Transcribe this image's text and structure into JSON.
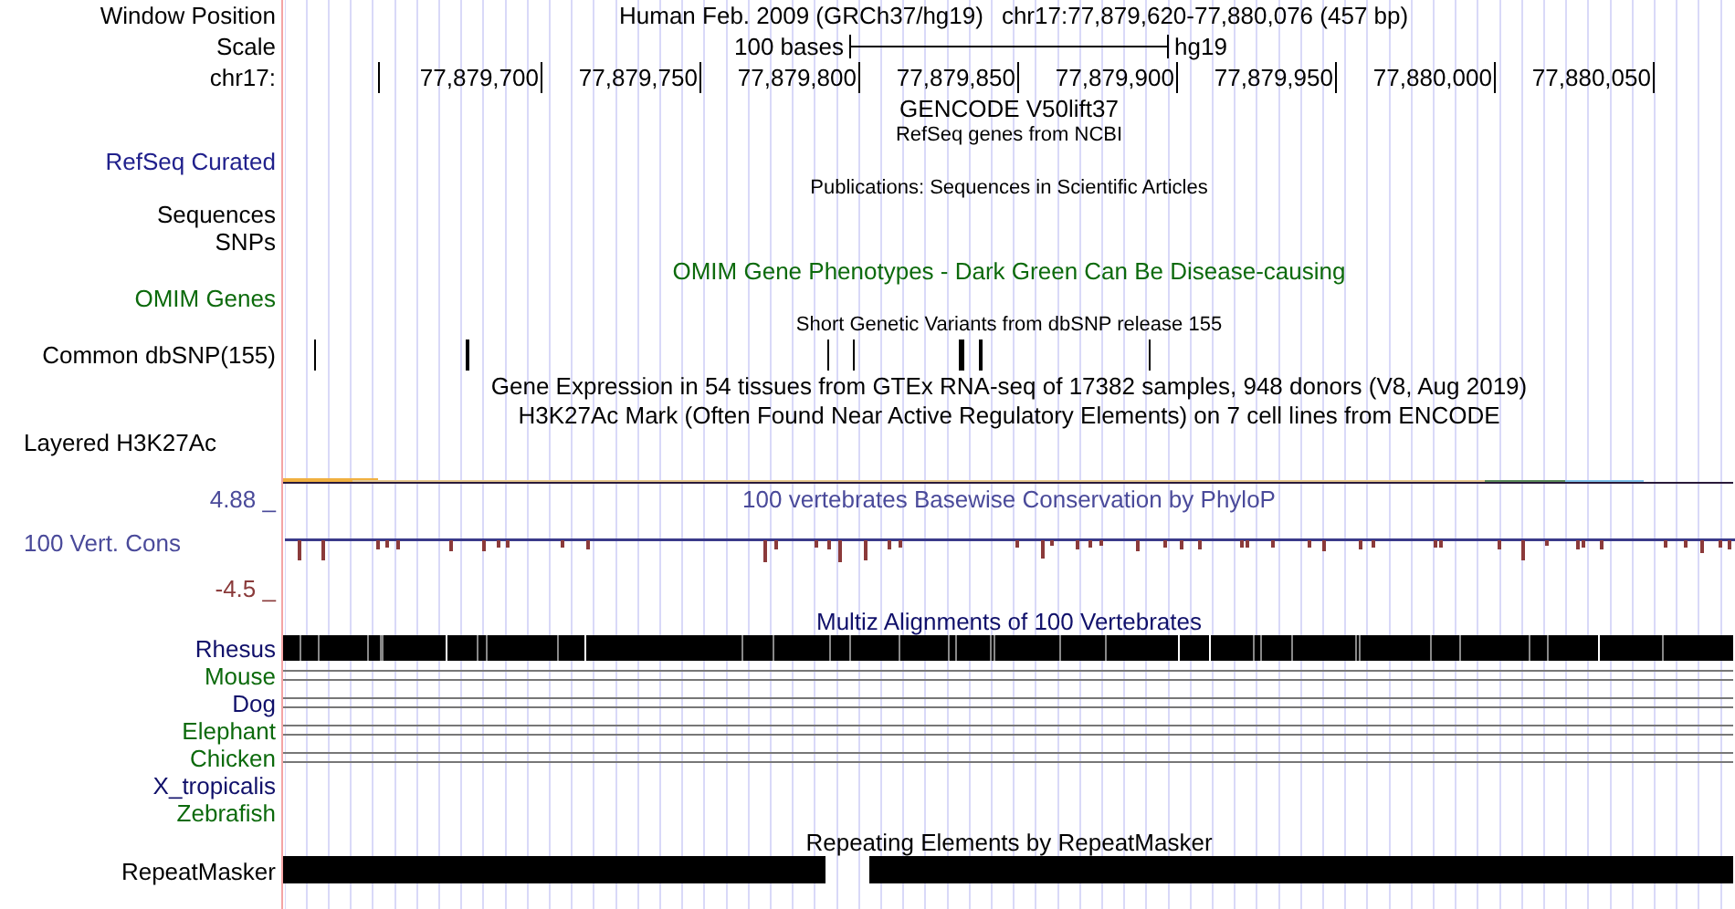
{
  "rows": [
    {
      "kind": "position",
      "label": "Window Position",
      "assembly": "Human Feb. 2009 (GRCh37/hg19)",
      "position": "chr17:77,879,620-77,880,076 (457 bp)"
    },
    {
      "kind": "scale",
      "label": "Scale",
      "text": "100 bases",
      "db": "hg19"
    },
    {
      "kind": "ruler",
      "label": "chr17:",
      "ticks": [
        "77,879,700",
        "77,879,750",
        "77,879,800",
        "77,879,850",
        "77,879,900",
        "77,879,950",
        "77,880,000",
        "77,880,050"
      ]
    },
    {
      "kind": "title",
      "text": "GENCODE V50lift37",
      "color": "#000000"
    },
    {
      "kind": "caption",
      "text": "RefSeq genes from NCBI"
    },
    {
      "kind": "label",
      "label": "RefSeq Curated",
      "color": "#20208c"
    },
    {
      "kind": "caption",
      "text": "Publications: Sequences in Scientific Articles"
    },
    {
      "kind": "label",
      "label": "Sequences",
      "color": "#000000"
    },
    {
      "kind": "label",
      "label": "SNPs",
      "color": "#000000"
    },
    {
      "kind": "title",
      "text": "OMIM Gene Phenotypes - Dark Green Can Be Disease-causing",
      "color": "#0c6a0c"
    },
    {
      "kind": "label",
      "label": "OMIM Genes",
      "color": "#0c6a0c"
    },
    {
      "kind": "caption",
      "text": "Short Genetic Variants from dbSNP release 155"
    },
    {
      "kind": "snps",
      "label": "Common dbSNP(155)"
    },
    {
      "kind": "title",
      "text": "Gene Expression in 54 tissues from GTEx RNA-seq of 17382 samples, 948 donors (V8, Aug 2019)",
      "color": "#000000"
    },
    {
      "kind": "title",
      "text": "H3K27Ac Mark (Often Found Near Active Regulatory Elements) on 7 cell lines from ENCODE",
      "color": "#000000"
    },
    {
      "kind": "composite_label",
      "label": "Layered H3K27Ac"
    },
    {
      "kind": "layered"
    },
    {
      "kind": "wiggle",
      "max": "4.88 _",
      "label": "100 Vert. Cons",
      "min": "-4.5 _",
      "title": "100 vertebrates Basewise Conservation by PhyloP"
    },
    {
      "kind": "title",
      "text": "Multiz Alignments of 100 Vertebrates",
      "color": "#10106a"
    },
    {
      "kind": "blocks",
      "label": "Rhesus",
      "color": "#10106a"
    },
    {
      "kind": "lines",
      "label": "Mouse",
      "color": "#0c6a0c"
    },
    {
      "kind": "lines",
      "label": "Dog",
      "color": "#10106a"
    },
    {
      "kind": "lines",
      "label": "Elephant",
      "color": "#0c6a0c"
    },
    {
      "kind": "lines",
      "label": "Chicken",
      "color": "#0c6a0c"
    },
    {
      "kind": "empty",
      "label": "X_tropicalis",
      "color": "#10106a"
    },
    {
      "kind": "empty",
      "label": "Zebrafish",
      "color": "#0c6a0c"
    },
    {
      "kind": "title",
      "text": "Repeating Elements by RepeatMasker",
      "color": "#000000"
    },
    {
      "kind": "repeat",
      "label": "RepeatMasker"
    }
  ]
}
